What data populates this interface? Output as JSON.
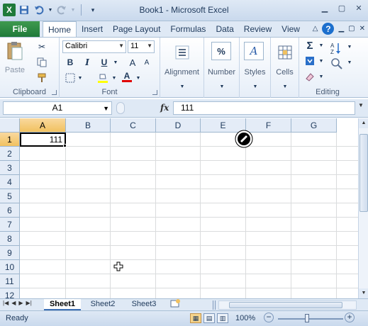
{
  "window": {
    "title": "Book1 - Microsoft Excel"
  },
  "qat": {
    "logo": "X",
    "save_icon": "save-icon",
    "undo_icon": "undo-icon",
    "redo_icon": "redo-icon"
  },
  "tabs": {
    "file": "File",
    "items": [
      "Home",
      "Insert",
      "Page Layout",
      "Formulas",
      "Data",
      "Review",
      "View"
    ],
    "active": "Home"
  },
  "ribbon": {
    "clipboard": {
      "label": "Clipboard",
      "paste": "Paste"
    },
    "font": {
      "label": "Font",
      "name": "Calibri",
      "size": "11",
      "bold": "B",
      "italic": "I",
      "underline": "U",
      "grow": "A",
      "shrink": "A",
      "color": "A"
    },
    "alignment": {
      "label": "Alignment"
    },
    "number": {
      "label": "Number",
      "icon_text": "%"
    },
    "styles": {
      "label": "Styles",
      "icon_text": "A"
    },
    "cells": {
      "label": "Cells"
    },
    "editing": {
      "label": "Editing",
      "sum": "Σ"
    }
  },
  "formula_bar": {
    "name_box": "A1",
    "fx": "fx",
    "content": "111"
  },
  "grid": {
    "columns": [
      "A",
      "B",
      "C",
      "D",
      "E",
      "F",
      "G"
    ],
    "rows": [
      "1",
      "2",
      "3",
      "4",
      "5",
      "6",
      "7",
      "8",
      "9",
      "10",
      "11",
      "12"
    ],
    "active_cell_value": "111",
    "selected_column": "A",
    "selected_row": "1"
  },
  "sheets": {
    "tabs": [
      "Sheet1",
      "Sheet2",
      "Sheet3"
    ],
    "active": "Sheet1"
  },
  "status": {
    "text": "Ready",
    "zoom": "100%",
    "zoom_minus": "−",
    "zoom_plus": "+"
  },
  "colors": {
    "file_tab": "#1f7a3a",
    "selection_header": "#f1c15f",
    "ribbon_bg": "#dfe9f5"
  }
}
